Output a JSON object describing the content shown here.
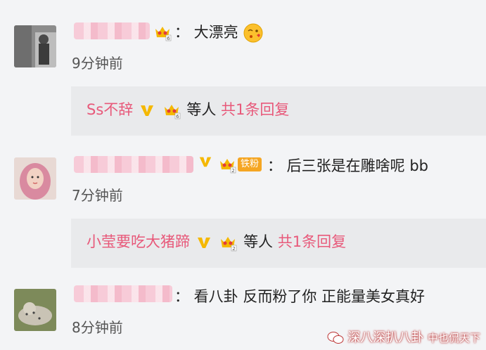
{
  "comments": [
    {
      "text": "： 大漂亮",
      "time": "9分钟前",
      "reply": {
        "name": "Ss不辞",
        "suffix": "等人",
        "count": "共1条回复"
      }
    },
    {
      "text": "： 后三张是在雕啥呢 bb",
      "badge": "铁粉",
      "time": "7分钟前",
      "reply": {
        "name": "小莹要吃大猪蹄",
        "suffix": "等人",
        "count": "共1条回复"
      }
    },
    {
      "text": "： 看八卦 反而粉了你 正能量美女真好",
      "time": "8分钟前"
    }
  ],
  "watermark": {
    "line1": "深八深扒八卦",
    "line2": "中也侃天下"
  },
  "colors": {
    "pink": "#e8597a",
    "background": "#f3f4f6",
    "reply_bg": "#e9eaec",
    "vip_gold": "#f5b800"
  }
}
